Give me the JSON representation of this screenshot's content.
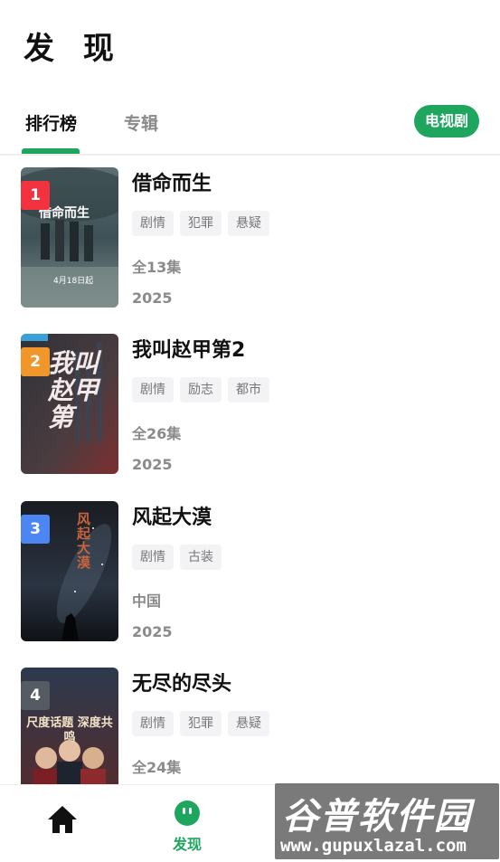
{
  "page": {
    "title": "发 现"
  },
  "tabs": {
    "items": [
      {
        "label": "排行榜"
      },
      {
        "label": "专辑"
      }
    ],
    "filter_chip": "电视剧"
  },
  "colors": {
    "accent": "#1ea65f",
    "rank1": "#f2333f",
    "rank2": "#f0962a",
    "rank3": "#4b86f2",
    "rank4": "#555b63"
  },
  "items": [
    {
      "rank": "1",
      "title": "借命而生",
      "tags": [
        "剧情",
        "犯罪",
        "悬疑"
      ],
      "meta1": "全13集",
      "meta2": "2025",
      "poster_text": "借命而生",
      "poster_date": "4月18日起"
    },
    {
      "rank": "2",
      "title": "我叫赵甲第2",
      "tags": [
        "剧情",
        "励志",
        "都市"
      ],
      "meta1": "全26集",
      "meta2": "2025",
      "poster_text": "我叫赵甲第"
    },
    {
      "rank": "3",
      "title": "风起大漠",
      "tags": [
        "剧情",
        "古装"
      ],
      "meta1": "中国",
      "meta2": "2025",
      "poster_text": "风起大漠"
    },
    {
      "rank": "4",
      "title": "无尽的尽头",
      "tags": [
        "剧情",
        "犯罪",
        "悬疑"
      ],
      "meta1": "全24集",
      "meta2": "",
      "poster_text": "尺度话题 深度共鸣"
    }
  ],
  "bottom_nav": {
    "home_icon": "home-icon",
    "discover_label": "发现",
    "discover_icon": "discover-icon"
  },
  "watermark": {
    "main": "谷普软件园",
    "url": "www.gupuxlazal.com"
  }
}
